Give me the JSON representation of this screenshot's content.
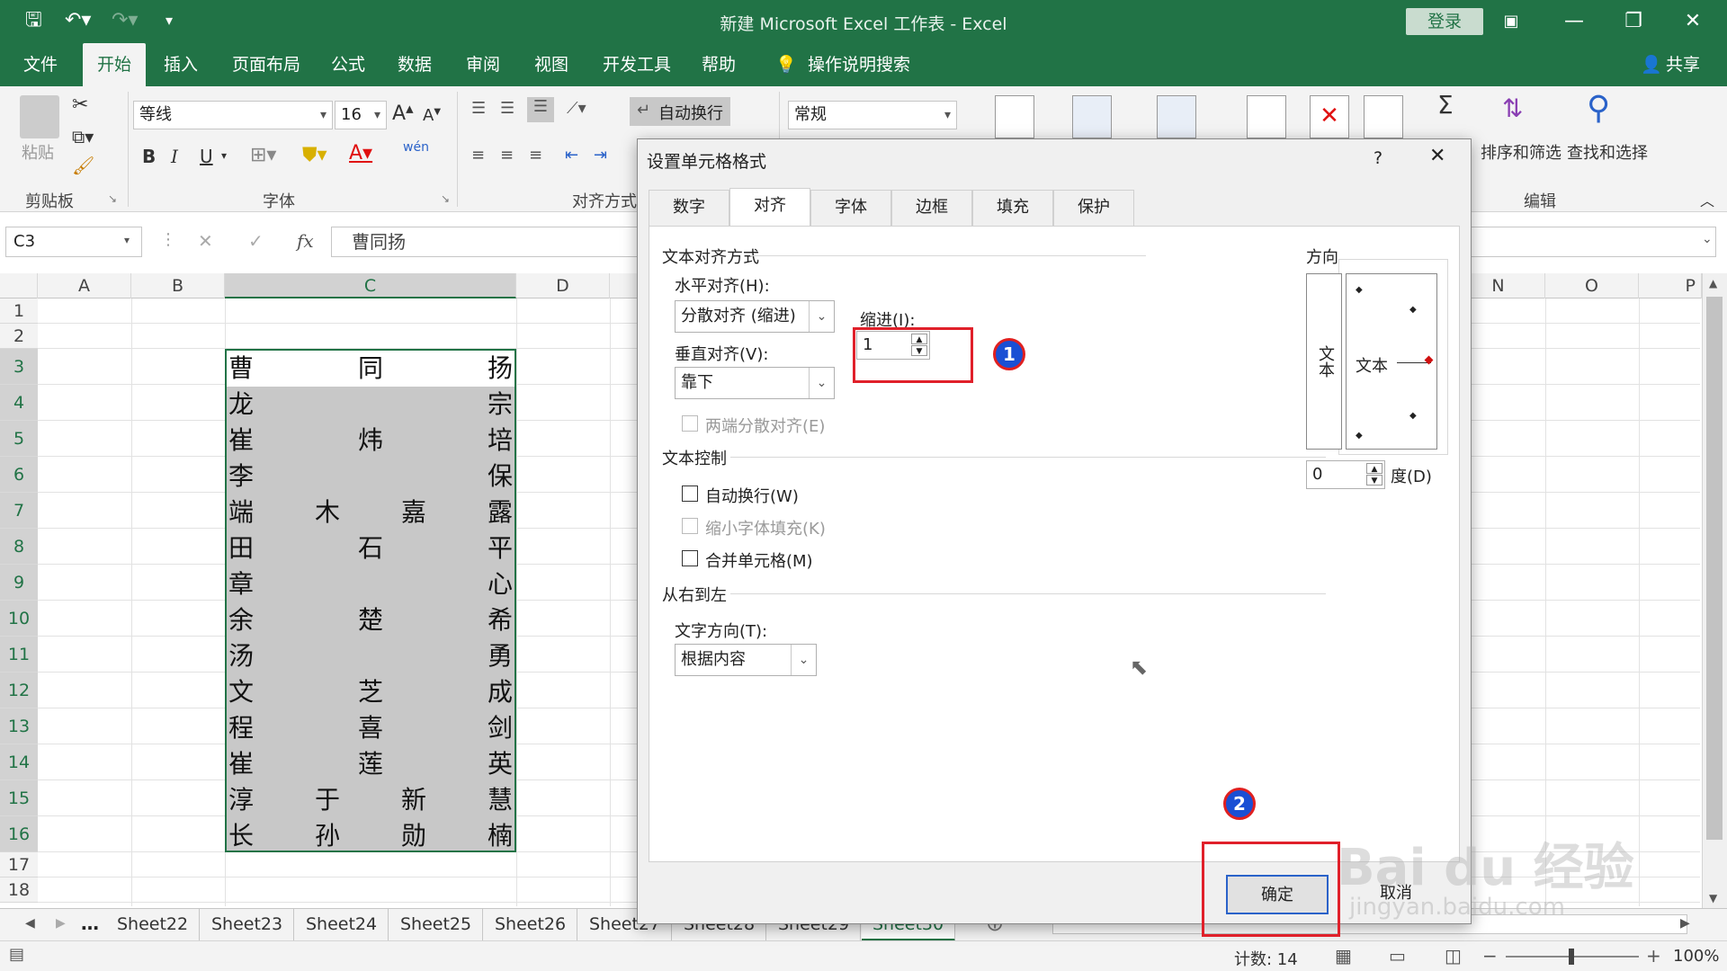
{
  "window": {
    "title": "新建 Microsoft Excel 工作表 - Excel",
    "login": "登录"
  },
  "menu": {
    "tabs": [
      "文件",
      "开始",
      "插入",
      "页面布局",
      "公式",
      "数据",
      "审阅",
      "视图",
      "开发工具",
      "帮助",
      "操作说明搜索"
    ],
    "share": "共享"
  },
  "ribbon": {
    "clipboard": {
      "paste": "粘贴",
      "group": "剪贴板"
    },
    "font": {
      "name": "等线",
      "size": "16",
      "group": "字体",
      "bold": "B",
      "italic": "I",
      "underline": "U",
      "phonetic": "wén"
    },
    "alignment": {
      "wrap": "自动换行",
      "group": "对齐方式"
    },
    "number": {
      "format": "常规"
    },
    "editing": {
      "sort": "排序和筛选",
      "find": "查找和选择",
      "group": "编辑",
      "sigma": "Σ"
    }
  },
  "formula_bar": {
    "name_box": "C3",
    "content": "曹同扬",
    "fx": "fx"
  },
  "grid": {
    "columns": [
      "A",
      "B",
      "C",
      "D",
      "",
      "",
      "",
      "",
      "",
      "",
      "",
      "",
      "",
      "",
      "N",
      "O",
      "P"
    ],
    "rows": [
      "1",
      "2",
      "3",
      "4",
      "5",
      "6",
      "7",
      "8",
      "9",
      "10",
      "11",
      "12",
      "13",
      "14",
      "15",
      "16",
      "17",
      "18"
    ],
    "cells": [
      [
        "曹",
        "同",
        "扬"
      ],
      [
        "龙",
        "宗"
      ],
      [
        "崔",
        "炜",
        "培"
      ],
      [
        "李",
        "保"
      ],
      [
        "端",
        "木",
        "嘉",
        "露"
      ],
      [
        "田",
        "石",
        "平"
      ],
      [
        "章",
        "心"
      ],
      [
        "余",
        "楚",
        "希"
      ],
      [
        "汤",
        "勇"
      ],
      [
        "文",
        "芝",
        "成"
      ],
      [
        "程",
        "喜",
        "剑"
      ],
      [
        "崔",
        "莲",
        "英"
      ],
      [
        "淳",
        "于",
        "新",
        "慧"
      ],
      [
        "长",
        "孙",
        "勋",
        "楠"
      ]
    ]
  },
  "sheets": [
    "Sheet22",
    "Sheet23",
    "Sheet24",
    "Sheet25",
    "Sheet26",
    "Sheet27",
    "Sheet28",
    "Sheet29",
    "Sheet30"
  ],
  "status": {
    "count": "计数: 14",
    "zoom": "100%"
  },
  "dialog": {
    "title": "设置单元格格式",
    "help": "?",
    "tabs": [
      "数字",
      "对齐",
      "字体",
      "边框",
      "填充",
      "保护"
    ],
    "text_align_section": "文本对齐方式",
    "horizontal_label": "水平对齐(H):",
    "horizontal_value": "分散对齐 (缩进)",
    "indent_label": "缩进(I):",
    "indent_value": "1",
    "vertical_label": "垂直对齐(V):",
    "vertical_value": "靠下",
    "justify_distributed": "两端分散对齐(E)",
    "text_control_section": "文本控制",
    "wrap_text": "自动换行(W)",
    "shrink_fit": "缩小字体填充(K)",
    "merge_cells": "合并单元格(M)",
    "rtl_section": "从右到左",
    "direction_label": "文字方向(T):",
    "direction_value": "根据内容",
    "orientation_section": "方向",
    "orientation_vertical_text": "文本",
    "orientation_text": "文本",
    "degree_value": "0",
    "degree_label": "度(D)",
    "ok": "确定",
    "cancel": "取消"
  },
  "annotations": {
    "badge1": "1",
    "badge2": "2"
  },
  "watermark": {
    "text": "Bai du 经验",
    "url": "jingyan.baidu.com"
  }
}
